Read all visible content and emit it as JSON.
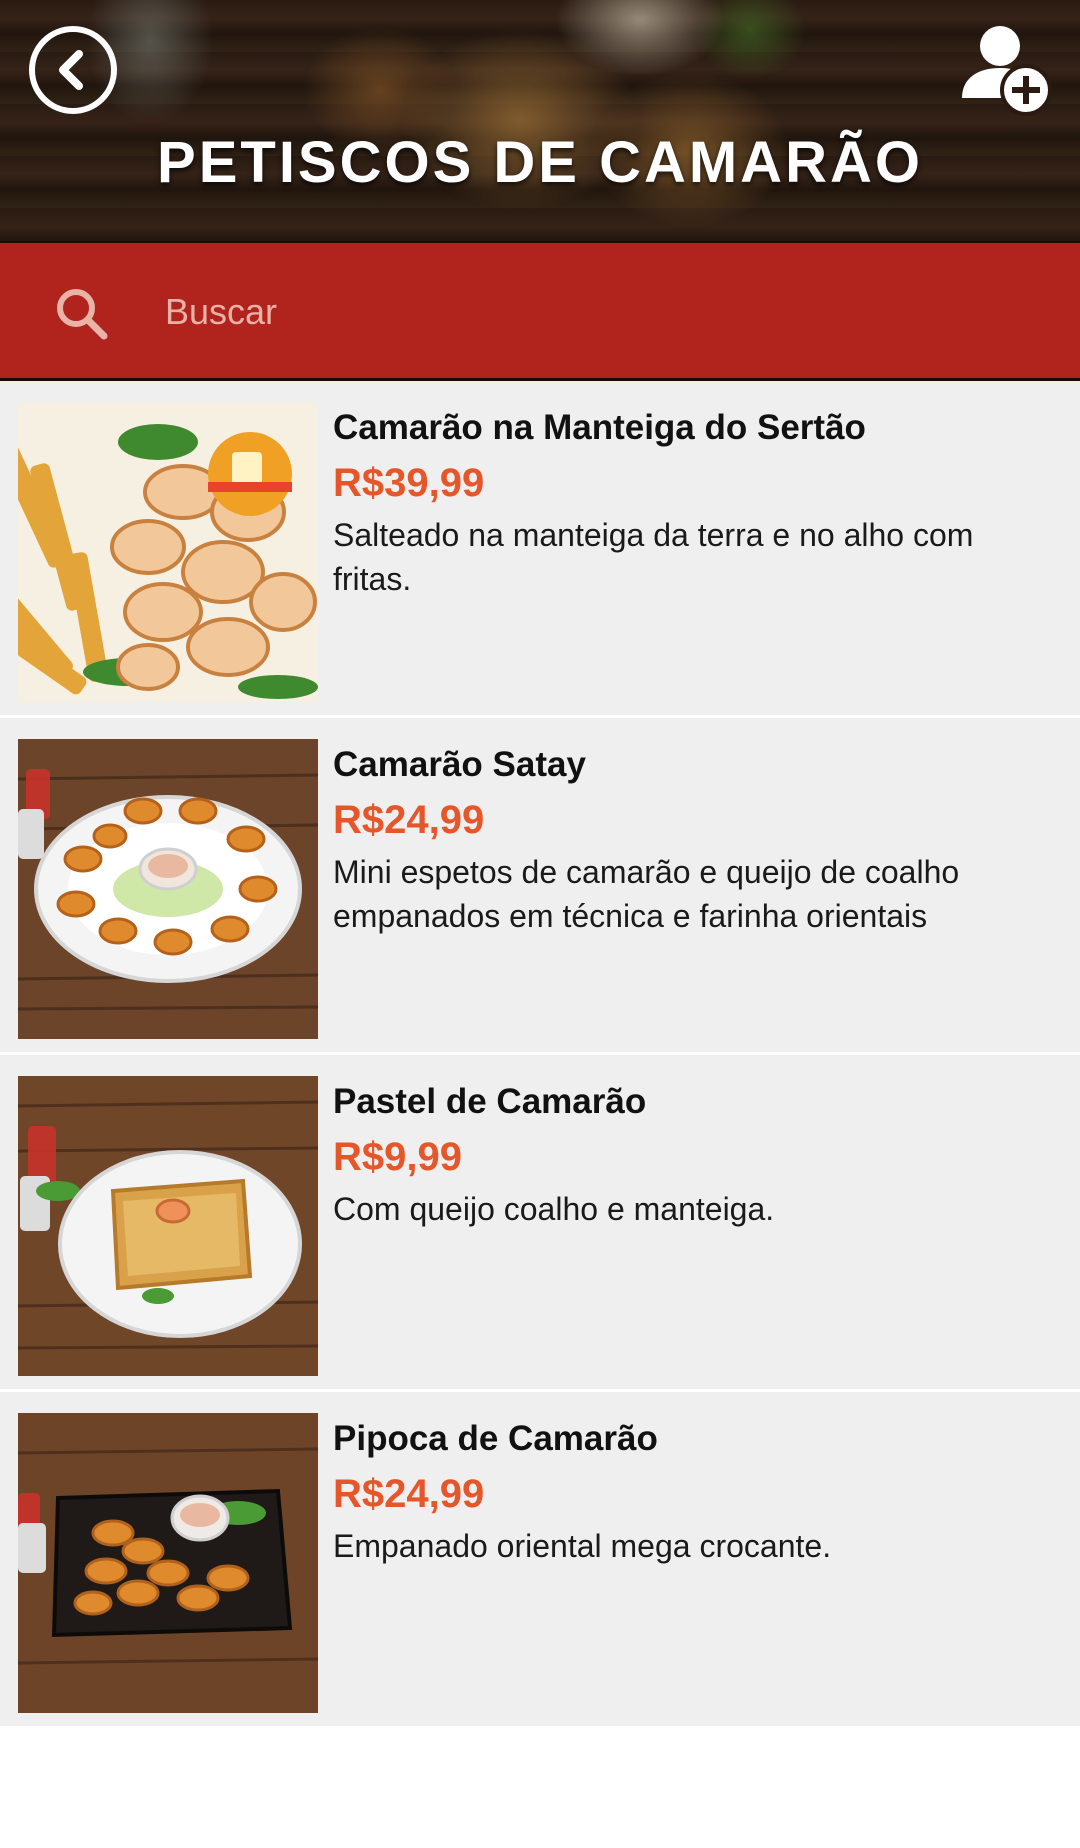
{
  "header": {
    "title": "PETISCOS DE CAMARÃO",
    "back_icon": "chevron-left-icon",
    "add_user_icon": "add-user-icon"
  },
  "search": {
    "placeholder": "Buscar",
    "value": "",
    "icon": "search-icon"
  },
  "colors": {
    "accent_red": "#b0241d",
    "price_orange": "#e5572b",
    "list_background": "#efefef"
  },
  "items": [
    {
      "name": "Camarão na Manteiga do Sertão",
      "price": "R$39,99",
      "description": "Salteado na manteiga da terra e no alho com fritas."
    },
    {
      "name": "Camarão Satay",
      "price": "R$24,99",
      "description": "Mini espetos de camarão e queijo de coalho empanados em técnica e farinha orientais"
    },
    {
      "name": "Pastel de Camarão",
      "price": "R$9,99",
      "description": "Com queijo coalho e manteiga."
    },
    {
      "name": "Pipoca de Camarão",
      "price": "R$24,99",
      "description": "Empanado oriental mega crocante."
    }
  ]
}
